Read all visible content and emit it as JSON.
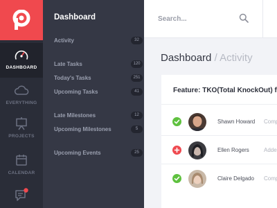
{
  "rail": {
    "items": [
      {
        "label": "DASHBOARD",
        "icon": "gauge-icon",
        "active": true
      },
      {
        "label": "EVERYTHING",
        "icon": "cloud-icon"
      },
      {
        "label": "PROJECTS",
        "icon": "presentation-board-icon"
      },
      {
        "label": "CALENDAR",
        "icon": "calendar-icon"
      },
      {
        "label": "",
        "icon": "chat-icon"
      }
    ],
    "brand_color": "#f0494e",
    "notification_color": "#f0494e"
  },
  "sidebar": {
    "title": "Dashboard",
    "items": [
      {
        "label": "Activity",
        "count": "32"
      },
      {
        "label": "Late Tasks",
        "count": "120"
      },
      {
        "label": "Today's Tasks",
        "count": "251"
      },
      {
        "label": "Upcoming Tasks",
        "count": "41"
      },
      {
        "label": "Late Milestones",
        "count": "12"
      },
      {
        "label": "Upcoming Milestones",
        "count": "5"
      },
      {
        "label": "Upcoming Events",
        "count": "25"
      }
    ]
  },
  "search": {
    "placeholder": "Search...",
    "icon": "search-icon"
  },
  "main": {
    "breadcrumb": {
      "section": "Dashboard",
      "separator": "/",
      "current": "Activity"
    },
    "card": {
      "title": "Feature: TKO(Total KnockOut) for",
      "rows": [
        {
          "name": "Shawn Howard",
          "status": "Comp",
          "state": "done"
        },
        {
          "name": "Ellen Rogers",
          "status": "Adde",
          "state": "add"
        },
        {
          "name": "Claire Delgado",
          "status": "Comp",
          "state": "done"
        }
      ]
    }
  },
  "colors": {
    "done": "#5fc13f",
    "added": "#ef4a50"
  }
}
